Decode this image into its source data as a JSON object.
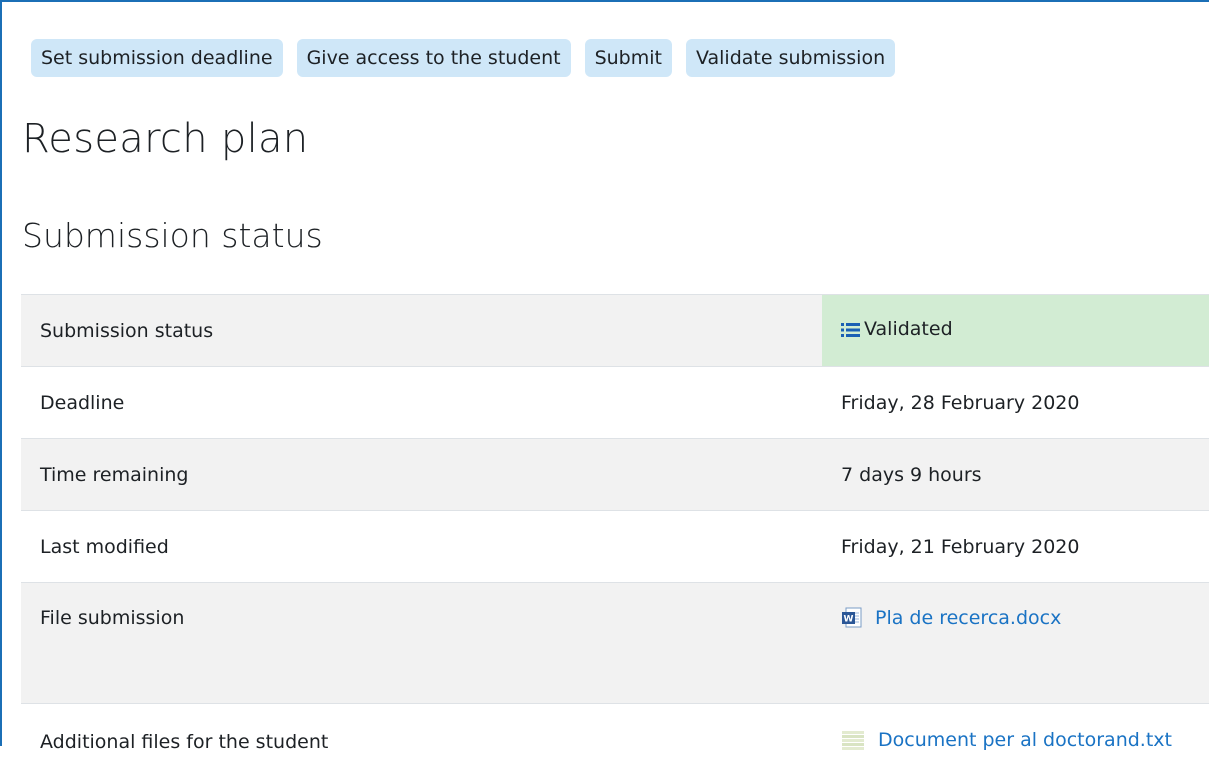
{
  "toolbar": {
    "buttons": [
      {
        "label": "Set submission deadline"
      },
      {
        "label": "Give access to the student"
      },
      {
        "label": "Submit"
      },
      {
        "label": "Validate submission"
      }
    ]
  },
  "page": {
    "title": "Research plan",
    "section_title": "Submission status"
  },
  "status": {
    "rows": [
      {
        "label": "Submission status",
        "value": "Validated",
        "icon": "list-icon",
        "value_color": "#d2ecd3"
      },
      {
        "label": "Deadline",
        "value": "Friday, 28 February 2020"
      },
      {
        "label": "Time remaining",
        "value": "7 days 9 hours"
      },
      {
        "label": "Last modified",
        "value": "Friday, 21 February 2020"
      },
      {
        "label": "File submission",
        "value": "Pla de recerca.docx",
        "icon": "word-document-icon"
      },
      {
        "label": "Additional files for the student",
        "value": "Document per al doctorand.txt",
        "icon": "text-file-icon"
      }
    ]
  },
  "colors": {
    "button_bg": "#cfe7f8",
    "link": "#1a73c4",
    "validated_bg": "#d2ecd3",
    "accent_border": "#1b6fb6"
  }
}
